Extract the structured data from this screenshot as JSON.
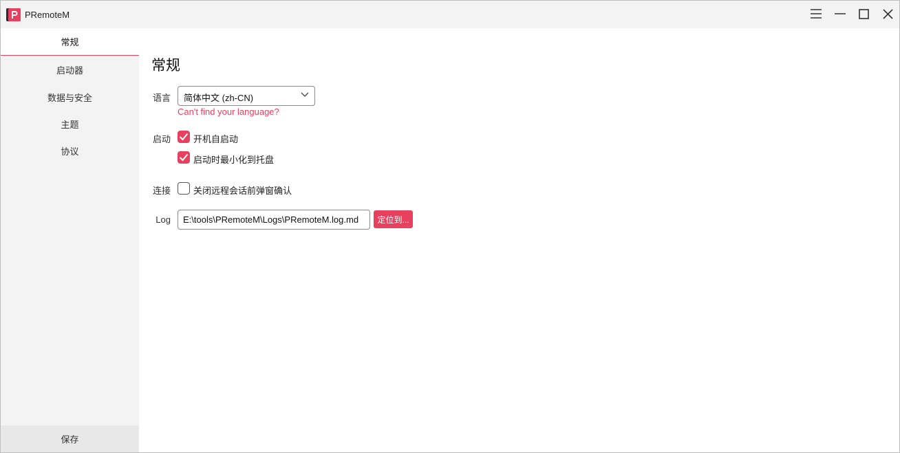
{
  "window": {
    "title": "PRemoteM",
    "app_icon": "premotem-logo",
    "controls": [
      "menu-icon",
      "minimize-icon",
      "maximize-icon",
      "close-icon"
    ]
  },
  "sidebar": {
    "items": [
      {
        "label": "常规",
        "active": true
      },
      {
        "label": "启动器",
        "active": false
      },
      {
        "label": "数据与安全",
        "active": false
      },
      {
        "label": "主题",
        "active": false
      },
      {
        "label": "协议",
        "active": false
      }
    ],
    "save_label": "保存"
  },
  "main": {
    "title": "常规",
    "language": {
      "label": "语言",
      "selected": "简体中文 (zh-CN)",
      "help_link": "Can't find your language?"
    },
    "startup": {
      "label": "启动",
      "options": [
        {
          "label": "开机自启动",
          "checked": true
        },
        {
          "label": "启动时最小化到托盘",
          "checked": true
        }
      ]
    },
    "connection": {
      "label": "连接",
      "option": {
        "label": "关闭远程会话前弹窗确认",
        "checked": false
      }
    },
    "log": {
      "label": "Log",
      "path": "E:\\tools\\PRemoteM\\Logs\\PRemoteM.log.md",
      "locate_label": "定位到..."
    }
  },
  "colors": {
    "accent": "#e8415f",
    "sidebar_bg": "#f3f3f3",
    "save_bg": "#e8e8e8"
  }
}
